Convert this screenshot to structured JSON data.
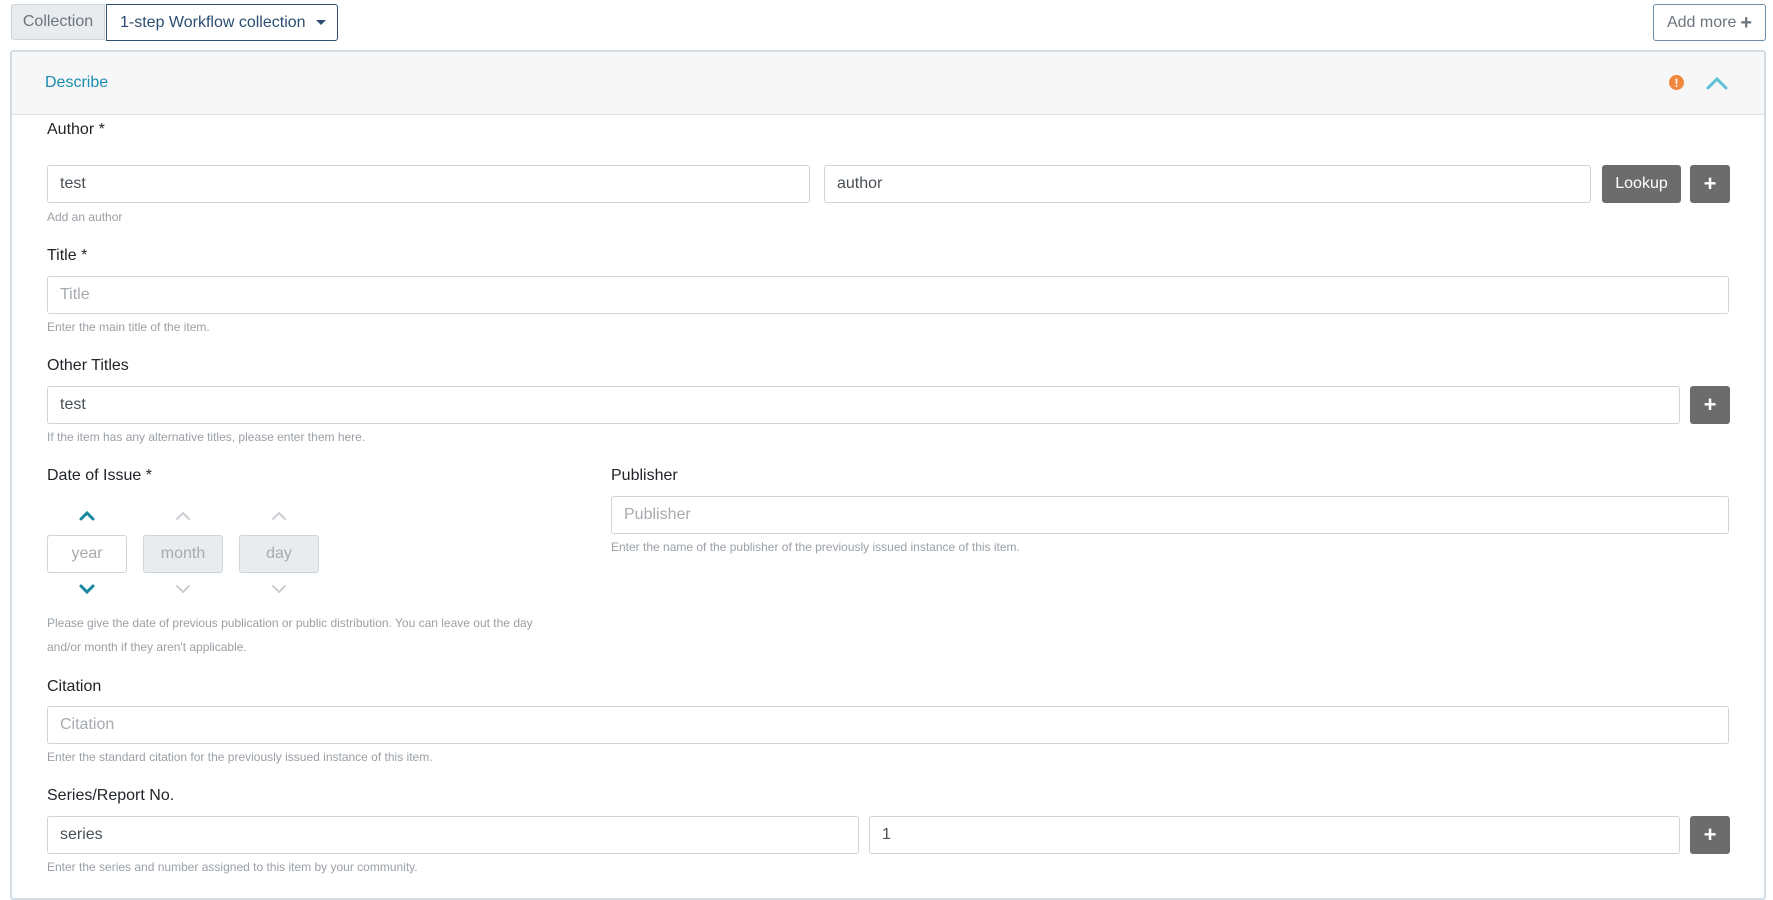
{
  "topbar": {
    "collection_label": "Collection",
    "collection_value": "1-step Workflow collection",
    "add_more_label": "Add more"
  },
  "section": {
    "title": "Describe",
    "warning_symbol": "!"
  },
  "author": {
    "label": "Author *",
    "last_value": "test",
    "first_value": "author",
    "lookup_label": "Lookup",
    "help": "Add an author"
  },
  "title_field": {
    "label": "Title *",
    "placeholder": "Title",
    "help": "Enter the main title of the item."
  },
  "other_titles": {
    "label": "Other Titles",
    "value": "test",
    "help": "If the item has any alternative titles, please enter them here."
  },
  "date": {
    "label": "Date of Issue *",
    "year_placeholder": "year",
    "month_placeholder": "month",
    "day_placeholder": "day",
    "help_line1": "Please give the date of previous publication or public distribution. You can leave out the day",
    "help_line2": "and/or month if they aren't applicable."
  },
  "publisher": {
    "label": "Publisher",
    "placeholder": "Publisher",
    "help": "Enter the name of the publisher of the previously issued instance of this item."
  },
  "citation": {
    "label": "Citation",
    "placeholder": "Citation",
    "help": "Enter the standard citation for the previously issued instance of this item."
  },
  "series": {
    "label": "Series/Report No.",
    "series_value": "series",
    "number_value": "1",
    "help": "Enter the series and number assigned to this item by your community."
  },
  "plus_symbol": "+",
  "colors": {
    "accent": "#1a8cb0",
    "teal_chevron": "#17889e",
    "warning": "#f0883e",
    "button_dark": "#6c6c6c"
  }
}
